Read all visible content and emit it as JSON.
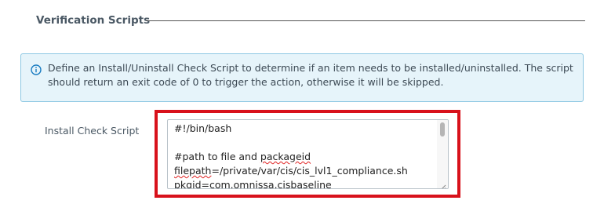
{
  "section": {
    "title": "Verification Scripts"
  },
  "info": {
    "icon": "info-circle-icon",
    "text": "Define an Install/Uninstall Check Script to determine if an item needs to be installed/uninstalled. The script should return an exit code of 0 to trigger the action, otherwise it will be skipped."
  },
  "install_check": {
    "label": "Install Check Script",
    "lines": [
      "#!/bin/bash",
      "",
      "#path to file and packageid",
      "filepath=/private/var/cis/cis_lvl1_compliance.sh",
      "pkgid=com.omnissa.cisbaseline"
    ]
  },
  "colors": {
    "highlight": "#d8111b",
    "info_bg": "#e6f4fa",
    "info_border": "#8ec8e3",
    "info_icon": "#1a7cc1"
  }
}
